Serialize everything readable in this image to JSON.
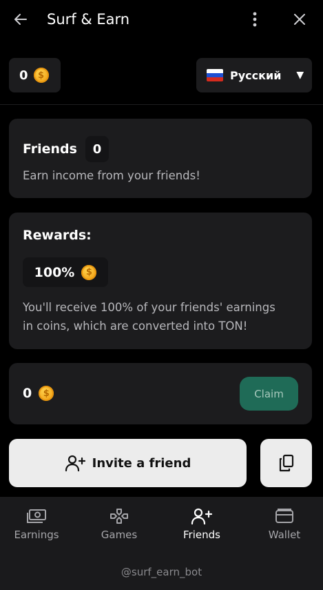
{
  "header": {
    "title": "Surf & Earn",
    "back_icon": "arrow-left-icon",
    "menu_icon": "more-vertical-icon",
    "close_icon": "close-icon"
  },
  "balance": {
    "value": "0",
    "icon": "coin-icon"
  },
  "language": {
    "selected": "Русский",
    "flag_icon": "russia-flag-icon",
    "chevron_icon": "triangle-down-icon"
  },
  "friends_card": {
    "title": "Friends",
    "count": "0",
    "description": "Earn income from your friends!"
  },
  "rewards_card": {
    "title": "Rewards:",
    "percent": "100%",
    "line1": "You'll receive 100% of your friends' earnings",
    "line2": "in coins, which are converted into TON!"
  },
  "claim_card": {
    "amount": "0",
    "claim_label": "Claim"
  },
  "invite": {
    "label": "Invite a friend",
    "icon": "user-plus-icon",
    "copy_icon": "copy-icon"
  },
  "nav": {
    "items": [
      {
        "label": "Earnings",
        "icon": "banknote-icon"
      },
      {
        "label": "Games",
        "icon": "gamepad-icon"
      },
      {
        "label": "Friends",
        "icon": "user-plus-icon",
        "active": true
      },
      {
        "label": "Wallet",
        "icon": "wallet-icon"
      }
    ]
  },
  "footer": {
    "handle": "@surf_earn_bot"
  },
  "colors": {
    "background": "#000000",
    "card": "#1c1c1e",
    "claim_button": "#1f6b57",
    "invite_button": "#ececec",
    "coin": "#f2a51a"
  }
}
